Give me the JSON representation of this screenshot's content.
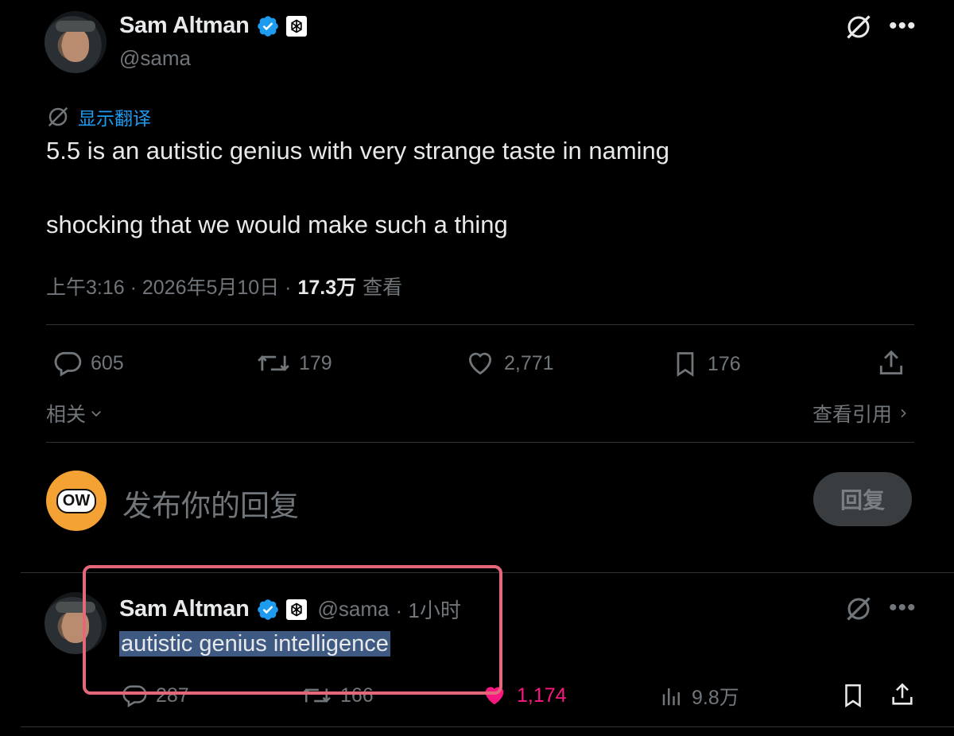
{
  "tweet": {
    "author_name": "Sam Altman",
    "author_handle": "@sama",
    "translate_label": "显示翻译",
    "text_line1": "5.5 is an autistic genius with very strange taste in naming",
    "text_line2": "shocking that we would make such a thing",
    "timestamp": "上午3:16 · 2026年5月10日 ·",
    "views_count": "17.3万",
    "views_label": "查看",
    "replies": "605",
    "retweets": "179",
    "likes": "2,771",
    "bookmarks": "176",
    "related_label": "相关",
    "quotes_label": "查看引用"
  },
  "compose": {
    "avatar_text": "OW",
    "placeholder": "发布你的回复",
    "reply_button": "回复"
  },
  "reply": {
    "author_name": "Sam Altman",
    "author_handle": "@sama",
    "time": "· 1小时",
    "text": "autistic genius intelligence",
    "replies": "287",
    "retweets": "166",
    "likes": "1,174",
    "views": "9.8万"
  },
  "colors": {
    "background": "#000000",
    "verified": "#1d9bf0",
    "like_active": "#f91880",
    "highlight": "#3f5a82",
    "annotation_box": "#e4677a",
    "compose_avatar": "#f4a233"
  },
  "icons": [
    "grok-icon",
    "more-icon",
    "translate-icon",
    "reply-icon",
    "retweet-icon",
    "like-icon",
    "bookmark-icon",
    "share-icon",
    "views-icon",
    "chevron-down-icon",
    "chevron-right-icon",
    "verified-icon",
    "openai-badge-icon"
  ]
}
